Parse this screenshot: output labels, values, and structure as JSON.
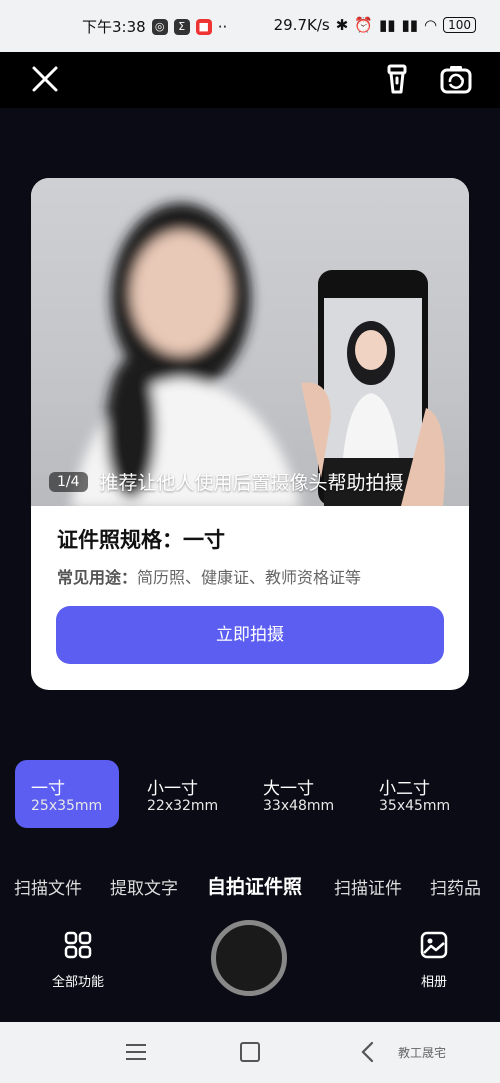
{
  "status_bar": {
    "time": "下午3:38",
    "speed": "29.7K/s",
    "battery": "100",
    "icons": [
      "wechat-icon",
      "sigma-icon",
      "news-icon",
      "dots-icon",
      "bluetooth-icon",
      "alarm-icon",
      "signal-hd-icon",
      "signal-hd-icon",
      "wifi-icon",
      "battery-icon"
    ]
  },
  "top_bar": {
    "icons": [
      "close-icon",
      "flashlight-icon",
      "switch-camera-icon"
    ]
  },
  "card": {
    "page_indicator": "1/4",
    "caption": "推荐让他人使用后置摄像头帮助拍摄",
    "spec_title": "证件照规格：一寸",
    "usage_label": "常见用途：",
    "usage_text": "简历照、健康证、教师资格证等",
    "button_label": "立即拍摄"
  },
  "sizes": [
    {
      "name": "一寸",
      "dim": "25x35mm",
      "active": true
    },
    {
      "name": "小一寸",
      "dim": "22x32mm",
      "active": false
    },
    {
      "name": "大一寸",
      "dim": "33x48mm",
      "active": false
    },
    {
      "name": "小二寸",
      "dim": "35x45mm",
      "active": false
    }
  ],
  "modes": [
    {
      "label": "扫描文件",
      "active": false
    },
    {
      "label": "提取文字",
      "active": false
    },
    {
      "label": "自拍证件照",
      "active": true
    },
    {
      "label": "扫描证件",
      "active": false
    },
    {
      "label": "扫药品",
      "active": false
    }
  ],
  "bottom": {
    "all_functions": "全部功能",
    "album": "相册"
  },
  "watermark": "教工晟宅",
  "colors": {
    "accent": "#5b5ef0",
    "background": "#0a0b14"
  }
}
